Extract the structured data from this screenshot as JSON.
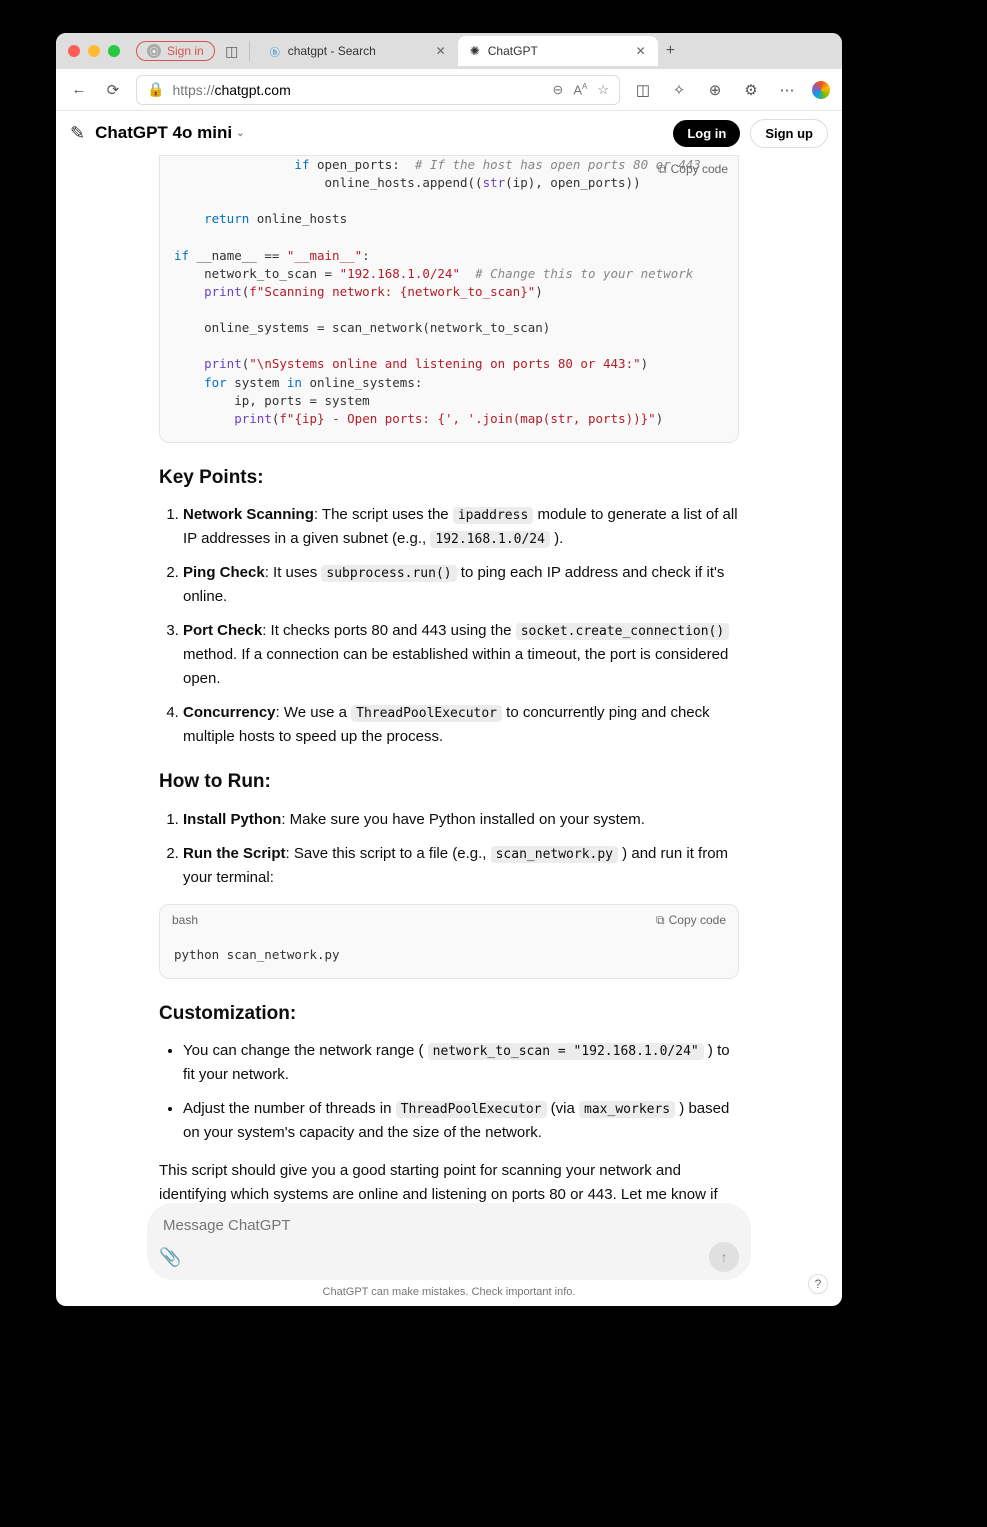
{
  "browser": {
    "signin_label": "Sign in",
    "tabs": [
      {
        "title": "chatgpt - Search",
        "icon": "bing",
        "active": false
      },
      {
        "title": "ChatGPT",
        "icon": "chatgpt",
        "active": true
      }
    ],
    "url_proto": "https://",
    "url_domain": "chatgpt.com"
  },
  "app": {
    "model": "ChatGPT 4o mini",
    "login": "Log in",
    "signup": "Sign up"
  },
  "code1": {
    "copy_label": "Copy code"
  },
  "code1_tokens": {
    "kw_if": "if",
    "t1": " open_ports:  ",
    "c1": "# If the host has open ports 80 or 443",
    "t2": "                    online_hosts.append((",
    "fn_str": "str",
    "t3": "(ip), open_ports))",
    "kw_return": "return",
    "t4": " online_hosts",
    "kw_if2": "if",
    "t5": " __name__ == ",
    "s_main": "\"__main__\"",
    "t6": ":",
    "t7": "    network_to_scan = ",
    "s_net": "\"192.168.1.0/24\"",
    "t8": "  ",
    "c2": "# Change this to your network",
    "fn_print1": "print",
    "t9": "(",
    "fs_a": "f\"Scanning network: ",
    "fs_b": "{network_to_scan}",
    "fs_c": "\"",
    "t10": ")",
    "t11": "    online_systems = scan_network(network_to_scan)",
    "fn_print2": "print",
    "t12": "(",
    "s_hdr": "\"\\nSystems online and listening on ports 80 or 443:\"",
    "t13": ")",
    "kw_for": "for",
    "t14": " system ",
    "kw_in": "in",
    "t15": " online_systems:",
    "t16": "        ip, ports = system",
    "fn_print3": "print",
    "t17": "(",
    "fs2_a": "f\"",
    "fs2_b": "{ip}",
    "fs2_c": " - Open ports: ",
    "fs2_d": "{', '.join(map(str, ports))}",
    "fs2_e": "\"",
    "t18": ")"
  },
  "headings": {
    "key_points": "Key Points:",
    "how_to_run": "How to Run:",
    "customization": "Customization:"
  },
  "key_points": {
    "p1_strong": "Network Scanning",
    "p1_a": ": The script uses the ",
    "p1_code": "ipaddress",
    "p1_b": " module to generate a list of all IP addresses in a given subnet (e.g., ",
    "p1_code2": "192.168.1.0/24",
    "p1_c": " ).",
    "p2_strong": "Ping Check",
    "p2_a": ": It uses ",
    "p2_code": "subprocess.run()",
    "p2_b": " to ping each IP address and check if it's online.",
    "p3_strong": "Port Check",
    "p3_a": ": It checks ports 80 and 443 using the ",
    "p3_code": "socket.create_connection()",
    "p3_b": " method. If a connection can be established within a timeout, the port is considered open.",
    "p4_strong": "Concurrency",
    "p4_a": ": We use a ",
    "p4_code": "ThreadPoolExecutor",
    "p4_b": " to concurrently ping and check multiple hosts to speed up the process."
  },
  "how_to_run": {
    "p1_strong": "Install Python",
    "p1_a": ": Make sure you have Python installed on your system.",
    "p2_strong": "Run the Script",
    "p2_a": ": Save this script to a file (e.g., ",
    "p2_code": "scan_network.py",
    "p2_b": " ) and run it from your terminal:"
  },
  "code2": {
    "lang": "bash",
    "copy_label": "Copy code",
    "body": "python scan_network.py"
  },
  "customization": {
    "b1_a": "You can change the network range ( ",
    "b1_code": "network_to_scan = \"192.168.1.0/24\"",
    "b1_b": " ) to fit your network.",
    "b2_a": "Adjust the number of threads in ",
    "b2_code1": "ThreadPoolExecutor",
    "b2_b": " (via ",
    "b2_code2": "max_workers",
    "b2_c": " ) based on your system's capacity and the size of the network."
  },
  "closing": "This script should give you a good starting point for scanning your network and identifying which systems are online and listening on ports 80 or 443. Let me know if you need any modifications or additional features!",
  "composer": {
    "placeholder": "Message ChatGPT"
  },
  "disclaimer": "ChatGPT can make mistakes. Check important info.",
  "help": "?"
}
